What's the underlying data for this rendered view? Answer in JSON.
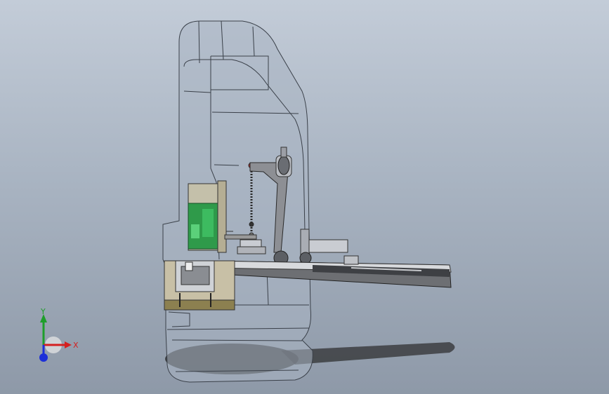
{
  "viewport": {
    "background_top": "#c3ccd8",
    "background_bottom": "#8e99a8"
  },
  "triad": {
    "x_label": "X",
    "y_label": "Y",
    "x_color": "#d42020",
    "y_color": "#1e9e2a",
    "z_color": "#1c2fd8"
  },
  "model": {
    "housing_color": "#a3aebd",
    "green_part_color": "#2f9a4a",
    "tan_block_color": "#c8c0a6",
    "rail_color": "#6d6f73"
  }
}
